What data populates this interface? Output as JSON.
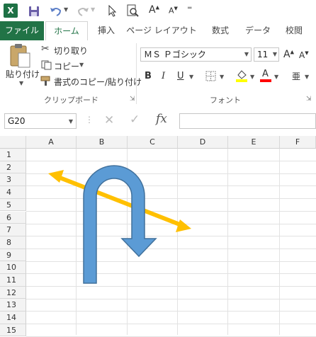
{
  "colors": {
    "excel_green": "#217346",
    "shape_fill": "#5b9bd5",
    "arrow": "#ffc000",
    "font_red": "#ff0000"
  },
  "qat": {
    "icons": [
      "excel-logo-icon",
      "save-icon",
      "undo-icon",
      "redo-icon",
      "pointer-icon",
      "print-preview-icon",
      "font-grow-icon",
      "font-shrink-icon",
      "customize-icon"
    ],
    "logo": "X"
  },
  "tabs": [
    {
      "label": "ファイル"
    },
    {
      "label": "ホーム"
    },
    {
      "label": "挿入"
    },
    {
      "label": "ページ レイアウト"
    },
    {
      "label": "数式"
    },
    {
      "label": "データ"
    },
    {
      "label": "校閲"
    }
  ],
  "clipboard": {
    "paste": "貼り付け",
    "cut": "切り取り",
    "copy": "コピー",
    "format_painter": "書式のコピー/貼り付け",
    "group_label": "クリップボード"
  },
  "font": {
    "name": "ＭＳ Ｐゴシック",
    "size": "11",
    "bold": "B",
    "italic": "I",
    "underline": "U",
    "font_color_letter": "A",
    "grow": "A",
    "shrink": "A",
    "group_label": "フォント"
  },
  "formula_bar": {
    "name_box": "G20",
    "fx": "fx",
    "value": ""
  },
  "grid": {
    "columns": [
      "A",
      "B",
      "C",
      "D",
      "E",
      "F"
    ],
    "rows": [
      "1",
      "2",
      "3",
      "4",
      "5",
      "6",
      "7",
      "8",
      "9",
      "10",
      "11",
      "12",
      "13",
      "14",
      "15"
    ]
  }
}
